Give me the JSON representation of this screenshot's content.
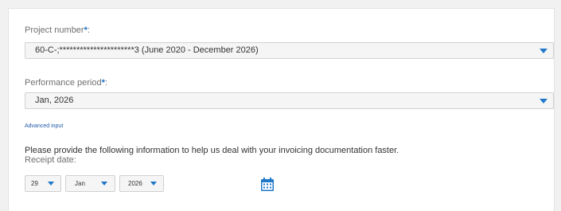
{
  "project": {
    "label": "Project number",
    "required_mark": "*",
    "label_suffix": ":",
    "value": "60-C-;**********************3 (June 2020 - December 2026)"
  },
  "performance": {
    "label": "Performance period",
    "required_mark": "*",
    "label_suffix": ":",
    "value": "Jan, 2026"
  },
  "advanced_input": "Advanced input",
  "info_text": "Please provide the following information to help us deal with your invoicing documentation faster.",
  "receipt": {
    "label": "Receipt date:",
    "day": "29",
    "month": "Jan",
    "year": "2026"
  },
  "icons": {
    "dropdown": "chevron-down-icon",
    "calendar": "calendar-icon"
  },
  "colors": {
    "accent": "#1f78c8",
    "link": "#1f5aa8",
    "required": "#1a73c9"
  }
}
